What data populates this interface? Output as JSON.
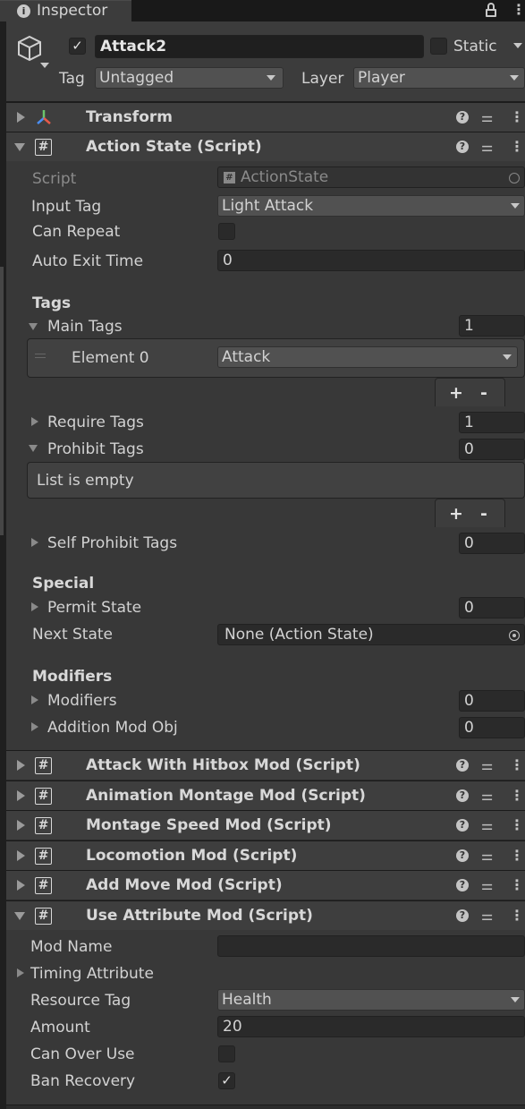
{
  "tab": {
    "title": "Inspector",
    "lock_icon": "lock-icon",
    "menu_icon": "kebab-icon"
  },
  "header": {
    "name": "Attack2",
    "static_label": "Static",
    "tag_label": "Tag",
    "tag_value": "Untagged",
    "layer_label": "Layer",
    "layer_value": "Player",
    "active_checked": true,
    "static_checked": false
  },
  "components": {
    "transform": "Transform",
    "action_state": "Action State (Script)",
    "attack_hitbox": "Attack With Hitbox Mod (Script)",
    "anim_montage": "Animation Montage Mod (Script)",
    "montage_speed": "Montage Speed Mod (Script)",
    "locomotion": "Locomotion Mod (Script)",
    "add_move": "Add Move Mod (Script)",
    "use_attribute": "Use Attribute Mod (Script)"
  },
  "action_state": {
    "script_label": "Script",
    "script_value": "ActionState",
    "input_tag_label": "Input Tag",
    "input_tag_value": "Light Attack",
    "can_repeat_label": "Can Repeat",
    "auto_exit_label": "Auto Exit Time",
    "auto_exit_value": "0",
    "tags_header": "Tags",
    "main_tags_label": "Main Tags",
    "main_tags_count": "1",
    "element0_label": "Element 0",
    "element0_value": "Attack",
    "require_tags_label": "Require Tags",
    "require_tags_count": "1",
    "prohibit_tags_label": "Prohibit Tags",
    "prohibit_tags_count": "0",
    "list_empty": "List is empty",
    "self_prohibit_label": "Self Prohibit Tags",
    "self_prohibit_count": "0",
    "special_header": "Special",
    "permit_state_label": "Permit State",
    "permit_state_count": "0",
    "next_state_label": "Next State",
    "next_state_value": "None (Action State)",
    "modifiers_header": "Modifiers",
    "modifiers_label": "Modifiers",
    "modifiers_count": "0",
    "addition_mod_label": "Addition Mod Obj",
    "addition_mod_count": "0",
    "plus": "+",
    "minus": "-"
  },
  "use_attribute": {
    "mod_name_label": "Mod Name",
    "mod_name_value": "",
    "timing_label": "Timing Attribute",
    "resource_tag_label": "Resource Tag",
    "resource_tag_value": "Health",
    "amount_label": "Amount",
    "amount_value": "20",
    "can_over_use_label": "Can Over Use",
    "can_over_use": false,
    "ban_recovery_label": "Ban Recovery",
    "ban_recovery": true
  },
  "icons": {
    "help": "?",
    "check": "✓"
  }
}
